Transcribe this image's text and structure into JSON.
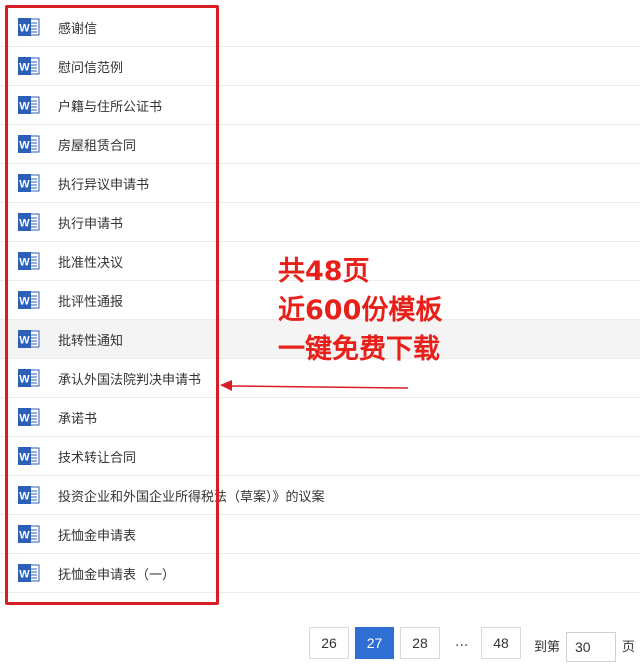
{
  "files": [
    {
      "label": "感谢信"
    },
    {
      "label": "慰问信范例"
    },
    {
      "label": "户籍与住所公证书"
    },
    {
      "label": "房屋租赁合同"
    },
    {
      "label": "执行异议申请书"
    },
    {
      "label": "执行申请书"
    },
    {
      "label": "批准性决议"
    },
    {
      "label": "批评性通报"
    },
    {
      "label": "批转性通知"
    },
    {
      "label": "承认外国法院判决申请书"
    },
    {
      "label": "承诺书"
    },
    {
      "label": "技术转让合同"
    },
    {
      "label": "投资企业和外国企业所得税法（草案）》的议案"
    },
    {
      "label": "抚恤金申请表"
    },
    {
      "label": "抚恤金申请表（一）"
    }
  ],
  "icon": {
    "name": "word-doc-icon",
    "letter": "W",
    "color": "#2b5fb8"
  },
  "annotation": {
    "line1": "共48页",
    "line2": "近600份模板",
    "line3": "一键免费下载",
    "color": "#e8201a"
  },
  "pagination": {
    "pages": [
      "26",
      "27",
      "28"
    ],
    "active": "27",
    "ellipsis": "...",
    "last": "48",
    "goto_label": "到第",
    "goto_value": "30",
    "suffix": "页"
  },
  "colors": {
    "frame": "#d81e24",
    "active_page": "#2f6fd3"
  }
}
